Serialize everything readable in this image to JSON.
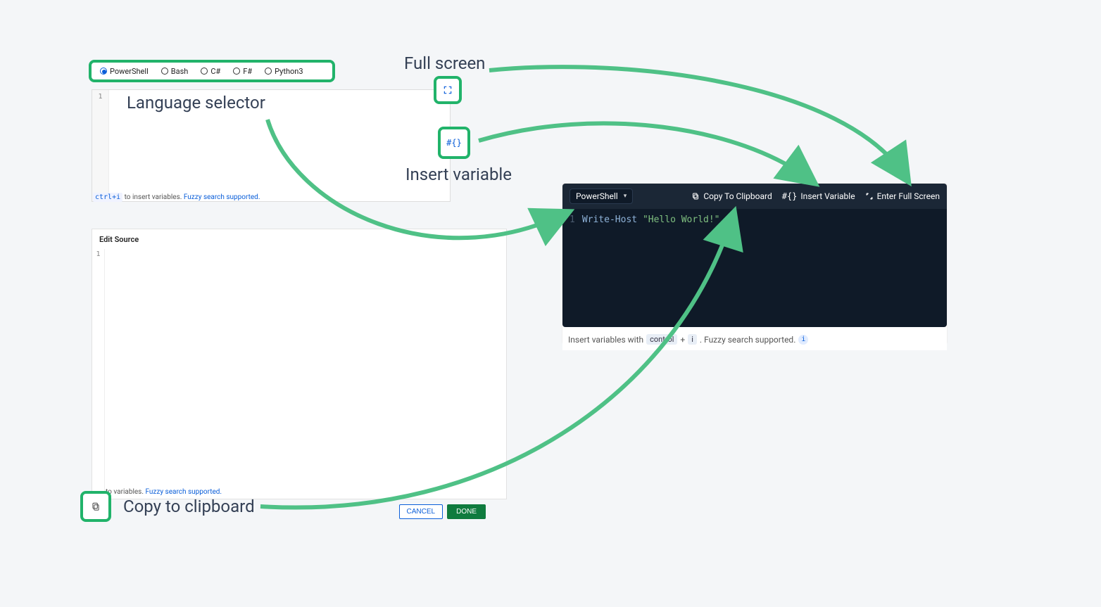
{
  "annotations": {
    "language_selector": "Language selector",
    "full_screen": "Full screen",
    "insert_variable": "Insert variable",
    "copy_to_clipboard": "Copy to clipboard"
  },
  "old": {
    "languages": [
      "PowerShell",
      "Bash",
      "C#",
      "F#",
      "Python3"
    ],
    "selected_language": "PowerShell",
    "line_number": "1",
    "hint_kbd": "ctrl+i",
    "hint_mid": "to insert variables.",
    "hint_link": "Fuzzy search supported.",
    "edit_source_title": "Edit Source",
    "edit_source_line": "1",
    "edit_hint_mid": "to variables.",
    "edit_hint_link": "Fuzzy search supported.",
    "cancel": "CANCEL",
    "done": "DONE",
    "insert_variable_icon_text": "#{}"
  },
  "new": {
    "language": "PowerShell",
    "copy_btn": "Copy To Clipboard",
    "insert_btn": "Insert Variable",
    "insert_btn_prefix": "#{}",
    "fullscreen_btn": "Enter Full Screen",
    "code_line_num": "1",
    "code_cmd": "Write-Host",
    "code_str": "\"Hello World!\"",
    "hint_pre": "Insert variables with",
    "hint_kbd1": "control",
    "hint_plus": "+",
    "hint_kbd2": "i",
    "hint_post": ". Fuzzy search supported.",
    "info": "i"
  }
}
